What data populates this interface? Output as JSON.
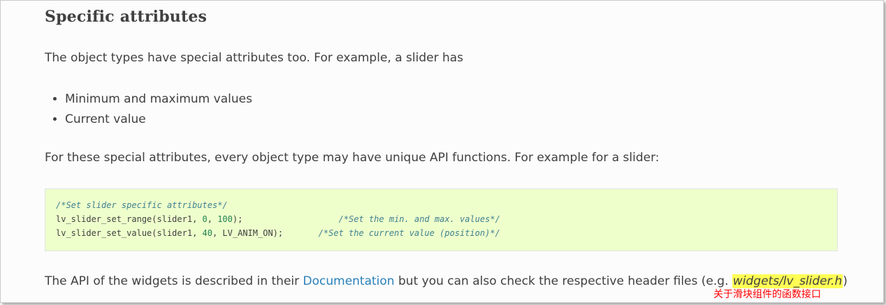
{
  "heading": "Specific attributes",
  "intro": "The object types have special attributes too. For example, a slider has",
  "bullets": [
    "Minimum and maximum values",
    "Current value"
  ],
  "para2": "For these special attributes, every object type may have unique API functions. For example for a slider:",
  "code": {
    "line1_comment": "/*Set slider specific attributes*/",
    "line2_fn": "lv_slider_set_range(slider1, ",
    "line2_n1": "0",
    "line2_sep": ", ",
    "line2_n2": "100",
    "line2_end": ");                   ",
    "line2_comment": "/*Set the min. and max. values*/",
    "line3_fn": "lv_slider_set_value(slider1, ",
    "line3_n1": "40",
    "line3_end": ", LV_ANIM_ON);       ",
    "line3_comment": "/*Set the current value (position)*/"
  },
  "para3": {
    "before": "The API of the widgets is described in their ",
    "link": "Documentation",
    "middle": " but you can also check the respective header files (e.g. ",
    "file": "widgets/lv_slider.h",
    "after": ")"
  },
  "annotation": "关于滑块组件的函数接口",
  "colors": {
    "code_bg": "#eeffcc",
    "comment": "#408090",
    "number": "#208050",
    "link": "#2980b9",
    "highlight": "#ffff55",
    "annotation": "#ff0000"
  }
}
